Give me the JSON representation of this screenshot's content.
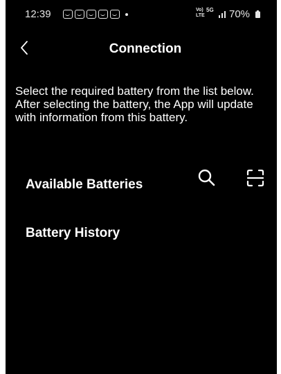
{
  "status_bar": {
    "time": "12:39",
    "network_label": "VoLTE",
    "network_type": "5G",
    "battery_percent": "70%",
    "notification_icons": [
      "notification-icon",
      "notification-icon",
      "notification-icon",
      "notification-icon",
      "notification-icon"
    ]
  },
  "header": {
    "title": "Connection",
    "back_icon": "chevron-left-icon"
  },
  "description": "Select the required battery from the list below. After selecting the battery, the App will update with information from this battery.",
  "sections": {
    "available": "Available Batteries",
    "history": "Battery History"
  },
  "actions": {
    "search_icon": "search-icon",
    "scan_icon": "scan-icon"
  },
  "colors": {
    "background": "#000000",
    "text": "#ffffff"
  }
}
